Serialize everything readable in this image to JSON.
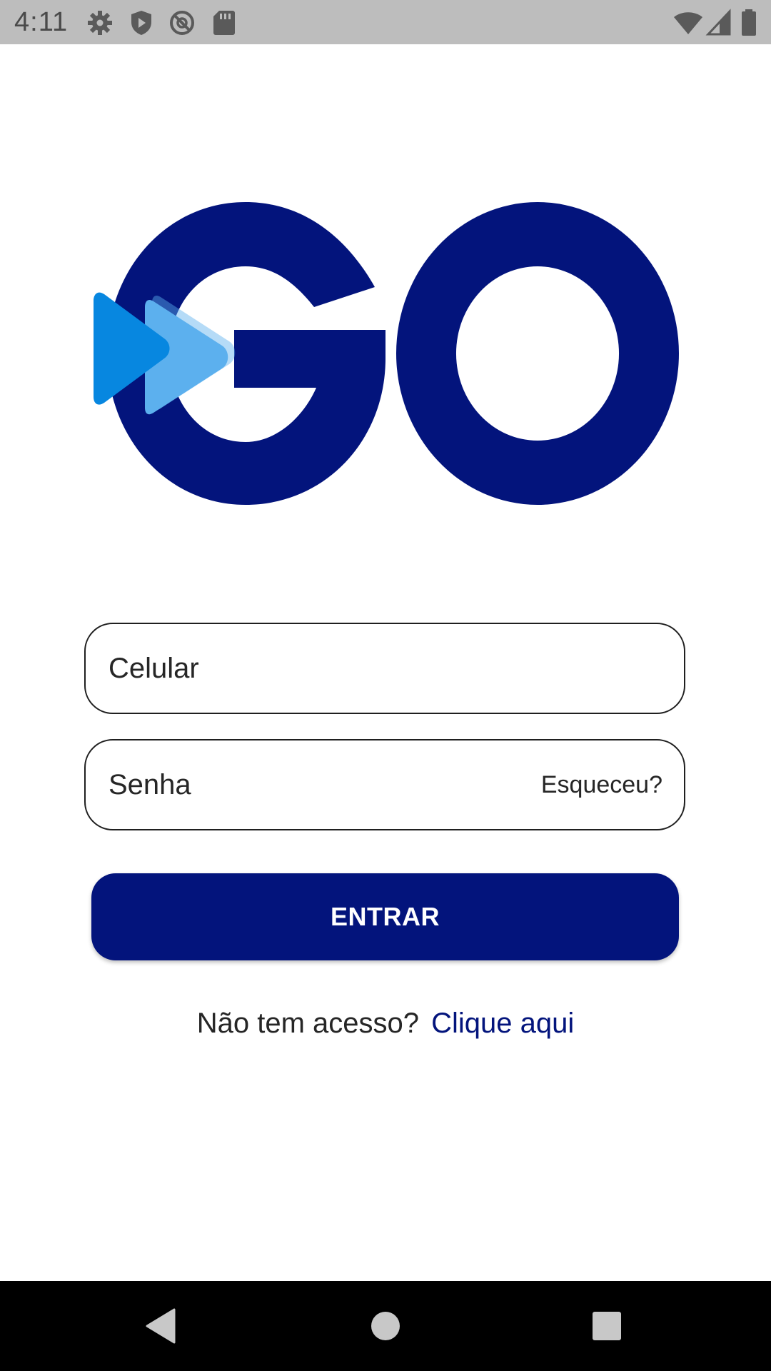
{
  "status_bar": {
    "time": "4:11",
    "left_icons": [
      "gear-icon",
      "shield-icon",
      "no-sync-icon",
      "sd-card-icon"
    ],
    "right_icons": [
      "wifi-icon",
      "signal-icon",
      "battery-icon"
    ]
  },
  "logo": {
    "text": "GO",
    "colors": {
      "primary": "#03147c",
      "accent": "#0787e0",
      "accent_light": "#5cb0ee"
    }
  },
  "form": {
    "phone_placeholder": "Celular",
    "password_placeholder": "Senha",
    "forgot_label": "Esqueceu?",
    "submit_label": "ENTRAR",
    "signup_prompt": "Não tem acesso?",
    "signup_link": "Clique aqui"
  },
  "nav_bar": {
    "buttons": [
      "back-icon",
      "home-icon",
      "recents-icon"
    ]
  },
  "colors": {
    "brand": "#03147c",
    "status_bar": "#bdbdbd",
    "nav_bar": "#000000",
    "text": "#262626"
  }
}
